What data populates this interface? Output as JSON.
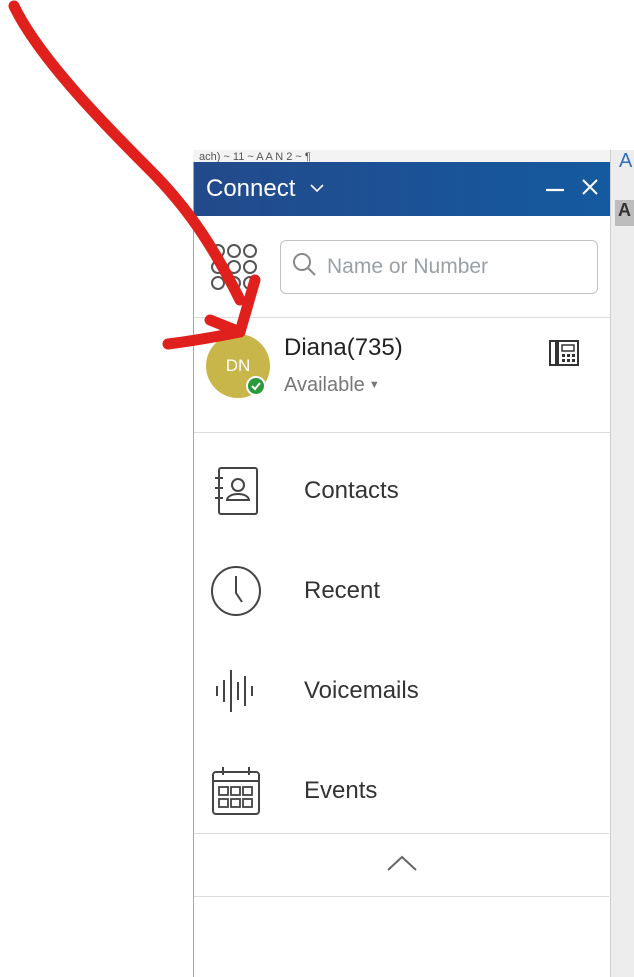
{
  "background": {
    "toolbar_text": "ach)  ~ 11  ~  A  A   N 2 ~  ¶"
  },
  "header": {
    "title": "Connect"
  },
  "search": {
    "placeholder": "Name or Number"
  },
  "user": {
    "initials": "DN",
    "name": "Diana(735)",
    "status": "Available",
    "avatar_color": "#c9b64a",
    "status_color": "#2a9a3c"
  },
  "nav": {
    "items": [
      {
        "label": "Contacts",
        "icon": "contacts-book-icon"
      },
      {
        "label": "Recent",
        "icon": "clock-icon"
      },
      {
        "label": "Voicemails",
        "icon": "waveform-icon"
      },
      {
        "label": "Events",
        "icon": "calendar-icon"
      }
    ]
  },
  "colors": {
    "header_bg": "#1a5398",
    "annotation_arrow": "#e0201c"
  }
}
